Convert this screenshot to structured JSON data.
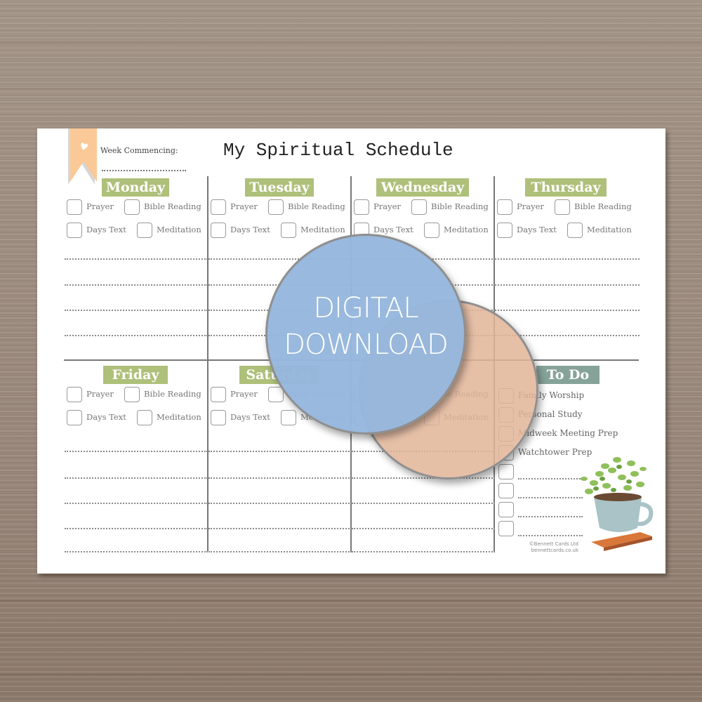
{
  "product": {
    "badge_line1": "DIGITAL",
    "badge_line2": "DOWNLOAD",
    "badge_colors": {
      "primary": "#96b7dd",
      "secondary": "#e2b498"
    }
  },
  "planner": {
    "title": "My Spiritual Schedule",
    "week_commencing_label": "Week Commencing:",
    "ribbon_icon": "heart-icon",
    "accent_color": "#aec07a",
    "todo_color": "#86a39a",
    "checklist": [
      "Prayer",
      "Bible Reading",
      "Days Text",
      "Meditation"
    ],
    "days": [
      {
        "name": "Monday"
      },
      {
        "name": "Tuesday"
      },
      {
        "name": "Wednesday"
      },
      {
        "name": "Thursday"
      },
      {
        "name": "Friday"
      },
      {
        "name": "Saturday"
      }
    ],
    "todo": {
      "title": "To Do",
      "items": [
        "Family Worship",
        "Personal Study",
        "Midweek Meeting Prep",
        "Watchtower Prep",
        "",
        "",
        "",
        ""
      ]
    },
    "illustration": "plant-in-teacup-on-book",
    "credit_line1": "©Bennett Cards Ltd",
    "credit_line2": "bennettcards.co.uk"
  }
}
